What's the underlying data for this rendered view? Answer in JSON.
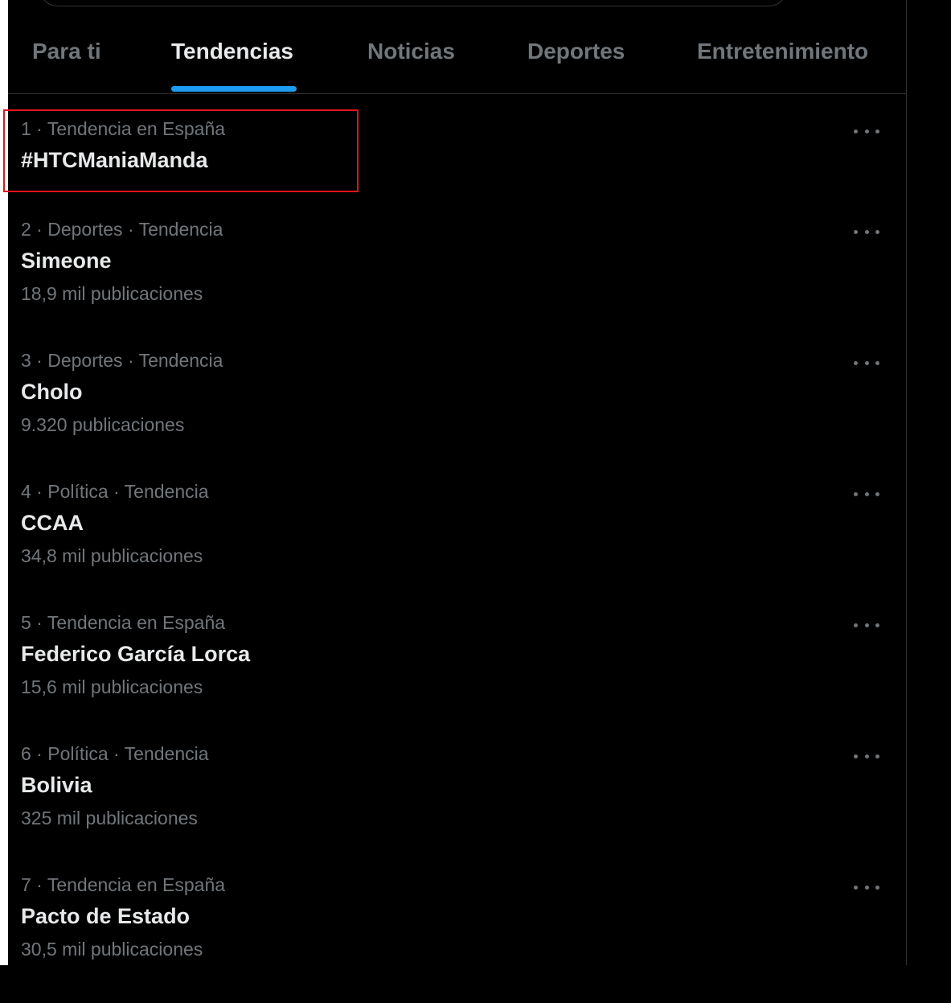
{
  "tabs": [
    {
      "label": "Para ti",
      "active": false
    },
    {
      "label": "Tendencias",
      "active": true
    },
    {
      "label": "Noticias",
      "active": false
    },
    {
      "label": "Deportes",
      "active": false
    },
    {
      "label": "Entretenimiento",
      "active": false
    }
  ],
  "trends": [
    {
      "meta": "1 · Tendencia en España",
      "name": "#HTCManiaManda",
      "count": ""
    },
    {
      "meta": "2 · Deportes · Tendencia",
      "name": "Simeone",
      "count": "18,9 mil publicaciones"
    },
    {
      "meta": "3 · Deportes · Tendencia",
      "name": "Cholo",
      "count": "9.320 publicaciones"
    },
    {
      "meta": "4 · Política · Tendencia",
      "name": "CCAA",
      "count": "34,8 mil publicaciones"
    },
    {
      "meta": "5 · Tendencia en España",
      "name": "Federico García Lorca",
      "count": "15,6 mil publicaciones"
    },
    {
      "meta": "6 · Política · Tendencia",
      "name": "Bolivia",
      "count": "325 mil publicaciones"
    },
    {
      "meta": "7 · Tendencia en España",
      "name": "Pacto de Estado",
      "count": "30,5 mil publicaciones"
    }
  ],
  "colors": {
    "background": "#000000",
    "primary_text": "#e7e9ea",
    "secondary_text": "#71767b",
    "accent": "#1d9bf0",
    "highlight": "#e0141e",
    "divider": "#2f3336"
  },
  "icons": {
    "more": "more-horizontal-icon"
  }
}
